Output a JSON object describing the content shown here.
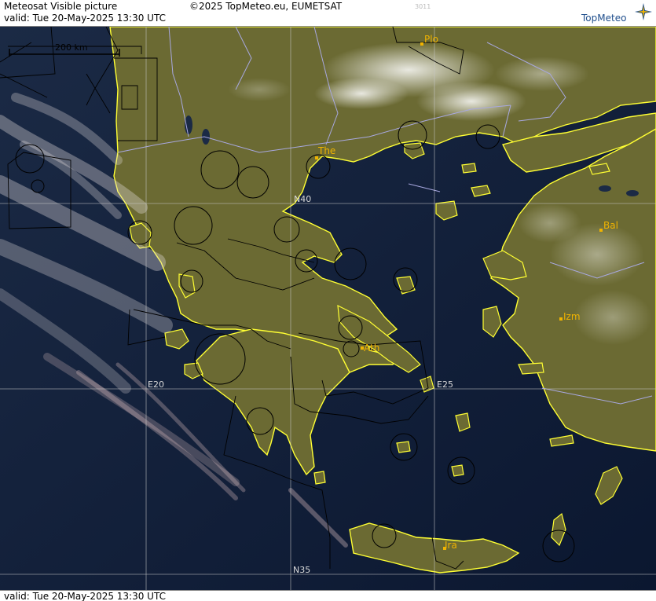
{
  "header": {
    "title": "Meteosat Visible picture",
    "copyright": "©2025 TopMeteo.eu, EUMETSAT",
    "code": "3011",
    "valid": "valid:  Tue  20-May-2025  13:30 UTC",
    "logo": "TopMeteo"
  },
  "map": {
    "scale_label": "200 km",
    "grid_labels": {
      "n40": "N40",
      "n35": "N35",
      "e20": "E20",
      "e25": "E25"
    },
    "cities": {
      "plo": "Plo",
      "the": "The",
      "bal": "Bal",
      "izm": "Izm",
      "ath": "Ath",
      "ira": "Ira"
    },
    "colors": {
      "sea": "#0d1b33",
      "land": "#6b6a33",
      "coast": "#ffff33",
      "city": "#f0b300",
      "grid": "#c8c8c8",
      "border": "#a8a8e0"
    }
  },
  "footer": {
    "valid": "valid:  Tue  20-May-2025  13:30 UTC"
  }
}
